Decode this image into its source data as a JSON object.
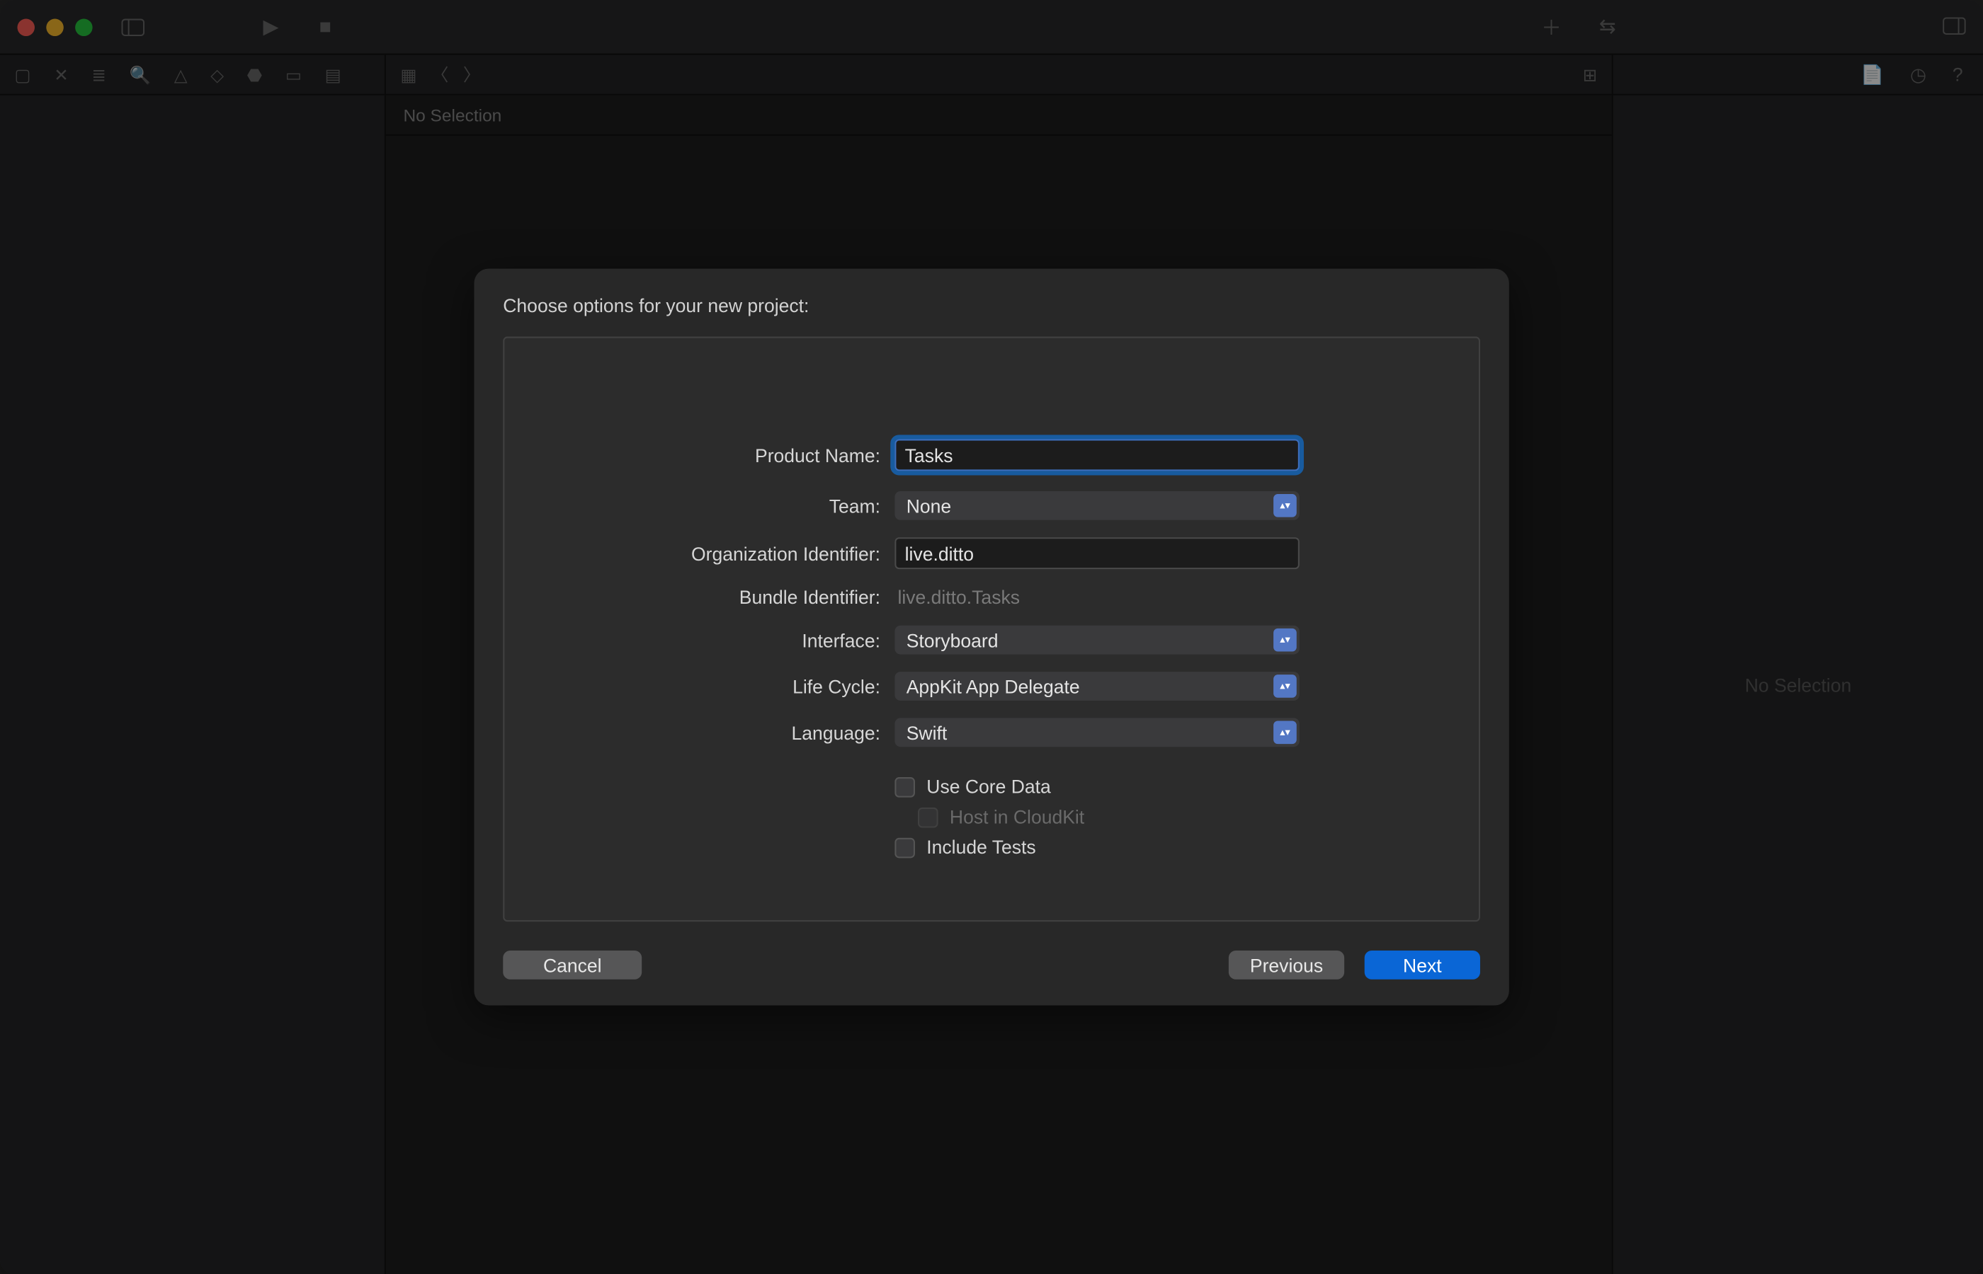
{
  "editor": {
    "no_selection": "No Selection"
  },
  "right_panel": {
    "no_selection": "No Selection"
  },
  "modal": {
    "title": "Choose options for your new project:",
    "fields": {
      "product_name": {
        "label": "Product Name:",
        "value": "Tasks"
      },
      "team": {
        "label": "Team:",
        "value": "None"
      },
      "org_id": {
        "label": "Organization Identifier:",
        "value": "live.ditto"
      },
      "bundle_id": {
        "label": "Bundle Identifier:",
        "value": "live.ditto.Tasks"
      },
      "interface": {
        "label": "Interface:",
        "value": "Storyboard"
      },
      "life_cycle": {
        "label": "Life Cycle:",
        "value": "AppKit App Delegate"
      },
      "language": {
        "label": "Language:",
        "value": "Swift"
      }
    },
    "checks": {
      "core_data": {
        "label": "Use Core Data",
        "checked": false
      },
      "cloudkit": {
        "label": "Host in CloudKit",
        "checked": false,
        "disabled": true
      },
      "tests": {
        "label": "Include Tests",
        "checked": false
      }
    },
    "buttons": {
      "cancel": "Cancel",
      "previous": "Previous",
      "next": "Next"
    }
  },
  "colors": {
    "accent": "#0a66d6"
  }
}
